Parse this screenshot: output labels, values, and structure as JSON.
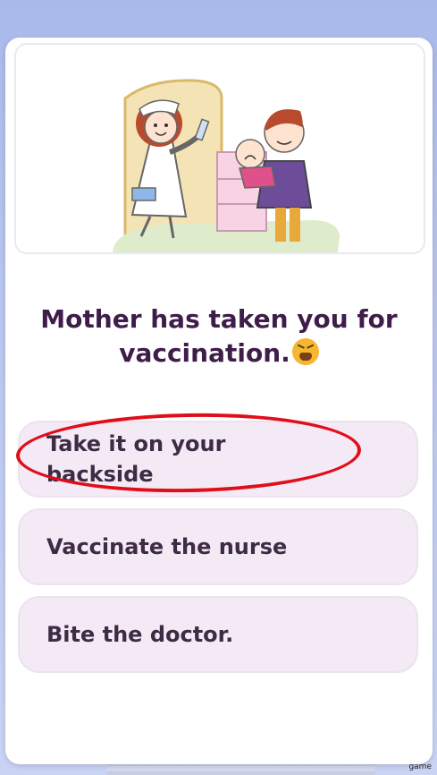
{
  "question": {
    "text": "Mother has taken you for vaccination.",
    "emoji": "crying-face-emoji"
  },
  "options": [
    {
      "label": "Take it on your\nbackside",
      "highlighted": true
    },
    {
      "label": "Vaccinate the nurse",
      "highlighted": false
    },
    {
      "label": "Bite the doctor.",
      "highlighted": false
    }
  ],
  "illustration": "nurse-with-syringe-father-holding-baby",
  "watermark": "game",
  "colors": {
    "background": "#b9c6ef",
    "question_text": "#3e1d4a",
    "option_bg": "#f4eaf5",
    "option_text": "#3e2b45",
    "highlight_ring": "#e00e1a"
  }
}
